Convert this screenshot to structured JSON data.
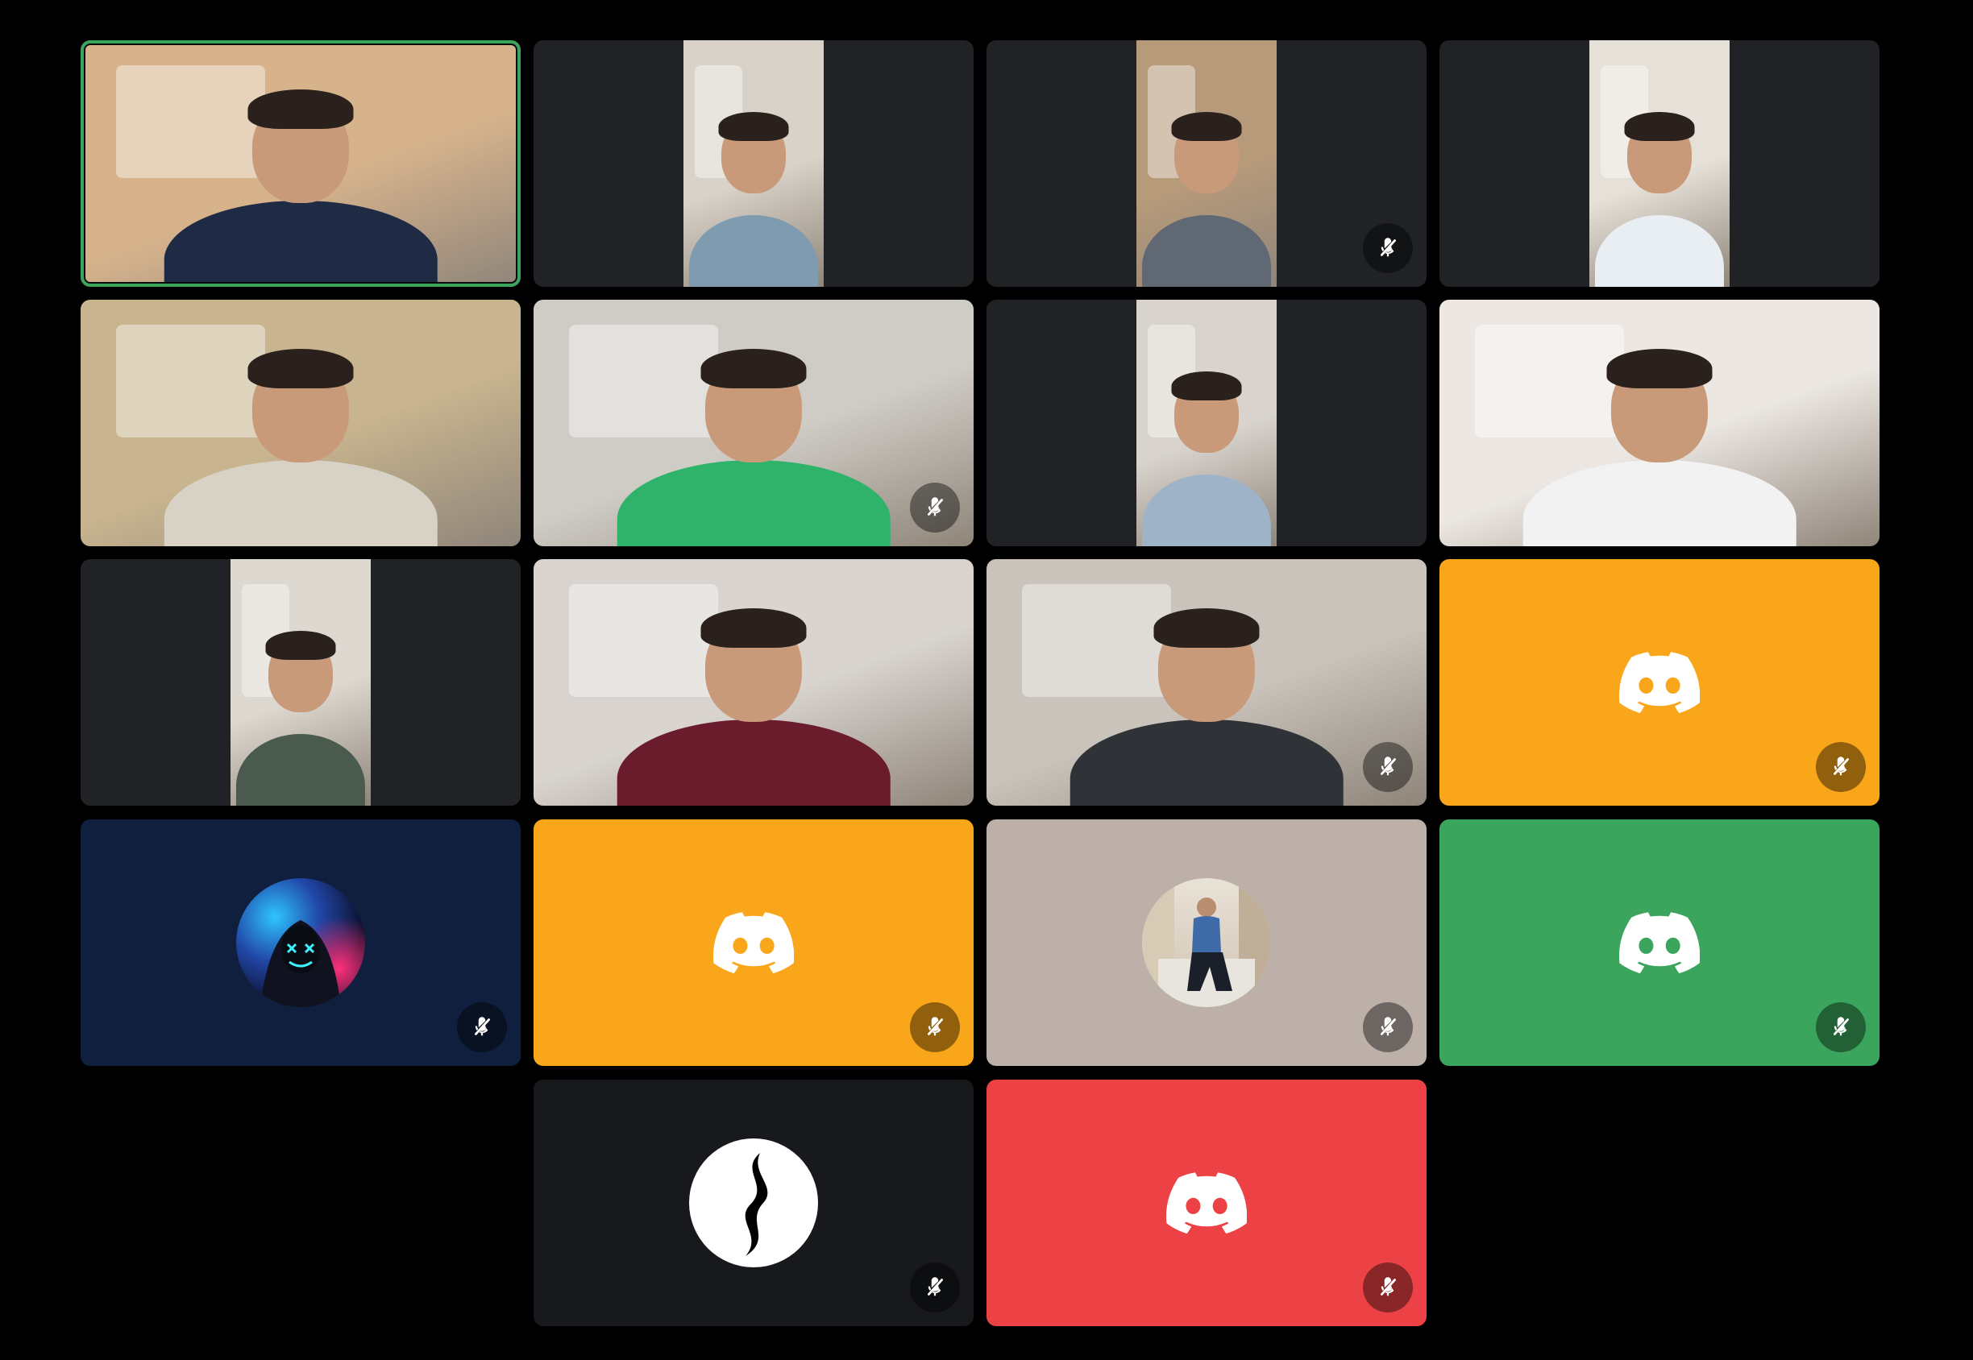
{
  "app": {
    "background": "#000000"
  },
  "colors": {
    "tile_dark": "#202225",
    "speaking_ring": "#3ba55d",
    "mute_icon": "#ffffff"
  },
  "participants": [
    {
      "kind": "video",
      "framing": "full",
      "speaking": true,
      "muted": false,
      "bg": "#d7b38c",
      "shirt": "#1f2a44"
    },
    {
      "kind": "video",
      "framing": "portrait",
      "speaking": false,
      "muted": false,
      "bg": "#d9d2c8",
      "shirt": "#7f9bb0"
    },
    {
      "kind": "video",
      "framing": "portrait",
      "speaking": false,
      "muted": true,
      "bg": "#b79a7a",
      "shirt": "#5f6873"
    },
    {
      "kind": "video",
      "framing": "portrait",
      "speaking": false,
      "muted": false,
      "bg": "#e6e1d8",
      "shirt": "#e8eef2"
    },
    {
      "kind": "video",
      "framing": "full",
      "speaking": false,
      "muted": false,
      "bg": "#c8b48e",
      "shirt": "#d8d2c6"
    },
    {
      "kind": "video",
      "framing": "full",
      "speaking": false,
      "muted": true,
      "bg": "#cfccc5",
      "shirt": "#2fb36b"
    },
    {
      "kind": "video",
      "framing": "portrait",
      "speaking": false,
      "muted": false,
      "bg": "#d8d3cd",
      "shirt": "#9fb3c8"
    },
    {
      "kind": "video",
      "framing": "full",
      "speaking": false,
      "muted": false,
      "bg": "#ece7e2",
      "shirt": "#f2f2f2"
    },
    {
      "kind": "video",
      "framing": "portrait",
      "speaking": false,
      "muted": false,
      "bg": "#ddd8d0",
      "shirt": "#4b5a4f"
    },
    {
      "kind": "video",
      "framing": "full",
      "speaking": false,
      "muted": false,
      "bg": "#d9d4cf",
      "shirt": "#6a1b2c"
    },
    {
      "kind": "video",
      "framing": "full",
      "speaking": false,
      "muted": true,
      "bg": "#c9c3bb",
      "shirt": "#2f3338"
    },
    {
      "kind": "discord-avatar",
      "bg": "#faa61a",
      "muted": true
    },
    {
      "kind": "image-avatar",
      "image": "masked-figure",
      "bg": "#0f1f3d",
      "muted": true
    },
    {
      "kind": "discord-avatar",
      "bg": "#faa61a",
      "muted": true
    },
    {
      "kind": "image-avatar",
      "image": "person-photo",
      "bg": "#bcb0a9",
      "muted": true
    },
    {
      "kind": "discord-avatar",
      "bg": "#3ba55d",
      "muted": true
    },
    {
      "kind": "image-avatar",
      "image": "black-logo",
      "bg": "#18191c",
      "muted": true
    },
    {
      "kind": "discord-avatar",
      "bg": "#ed4245",
      "muted": true
    }
  ]
}
